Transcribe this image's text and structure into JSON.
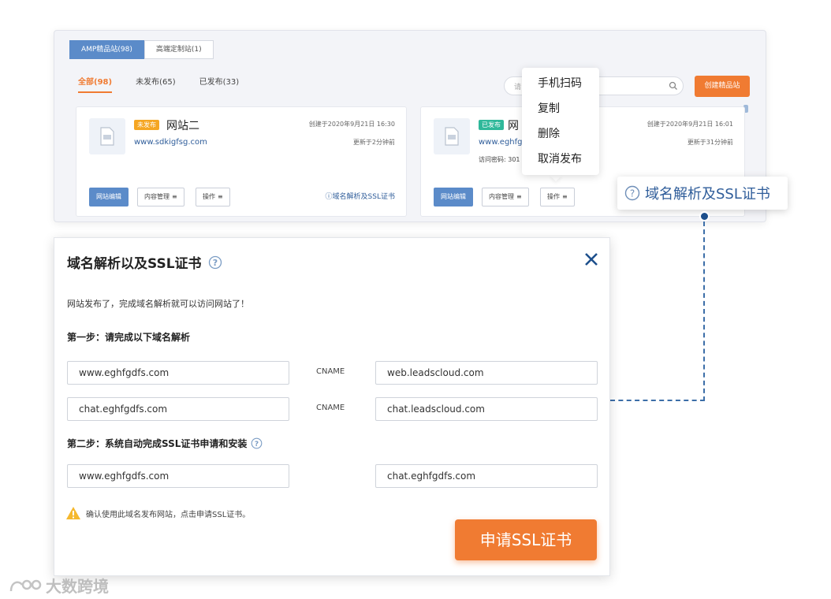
{
  "top": {
    "tabs": [
      {
        "label": "AMP精品站(98)"
      },
      {
        "label": "高端定制站(1)"
      }
    ],
    "filters": [
      {
        "label": "全部(98)"
      },
      {
        "label": "未发布(65)"
      },
      {
        "label": "已发布(33)"
      }
    ],
    "search_placeholder": "请",
    "create_button": "创建精品站"
  },
  "cards": [
    {
      "status": "未发布",
      "name": "网站二",
      "url": "www.sdkigfsg.com",
      "created": "创建于2020年9月21日 16:30",
      "updated": "更新于2分钟前",
      "btn_edit": "网站编辑",
      "btn_content": "内容管理",
      "btn_ops": "操作",
      "domain_link": "域名解析及SSL证书"
    },
    {
      "status": "已发布",
      "name": "网",
      "url": "www.eghfg",
      "visit_pwd": "访问密码: 301",
      "created": "创建于2020年9月21日 16:01",
      "updated": "更新于31分钟前",
      "btn_edit": "网站编辑",
      "btn_content": "内容管理",
      "btn_ops": "操作"
    }
  ],
  "dropdown": [
    {
      "label": "手机扫码"
    },
    {
      "label": "复制"
    },
    {
      "label": "删除"
    },
    {
      "label": "取消发布"
    }
  ],
  "callout": "域名解析及SSL证书",
  "dialog": {
    "title": "域名解析以及SSL证书",
    "intro": "网站发布了，完成域名解析就可以访问网站了！",
    "step1": "第一步：请完成以下域名解析",
    "rows": [
      {
        "left": "www.eghfgdfs.com",
        "type": "CNAME",
        "right": "web.leadscloud.com"
      },
      {
        "left": "chat.eghfgdfs.com",
        "type": "CNAME",
        "right": "chat.leadscloud.com"
      }
    ],
    "step2": "第二步：系统自动完成SSL证书申请和安装",
    "ssl_fields": {
      "left": "www.eghfgdfs.com",
      "right": "chat.eghfgdfs.com"
    },
    "warning": "确认使用此域名发布网站，点击申请SSL证书。",
    "ssl_button": "申请SSL证书"
  },
  "watermark": "大数跨境",
  "colors": {
    "accent": "#f07b32",
    "primary": "#5b8bc9",
    "link": "#2f5d9a",
    "connector": "#3c6ea8"
  }
}
